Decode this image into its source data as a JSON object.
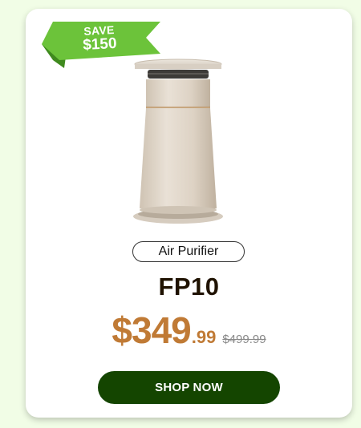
{
  "badge": {
    "line1": "SAVE",
    "line2": "$150",
    "color": "#6cc33a"
  },
  "product": {
    "category": "Air Purifier",
    "model": "FP10",
    "price_main": "$349",
    "price_cents": ".99",
    "price_original": "$499.99",
    "image_icon": "air-purifier-image"
  },
  "cta": {
    "label": "SHOP NOW",
    "color": "#144500"
  },
  "colors": {
    "background": "#f1fde6",
    "price": "#c07a35"
  }
}
